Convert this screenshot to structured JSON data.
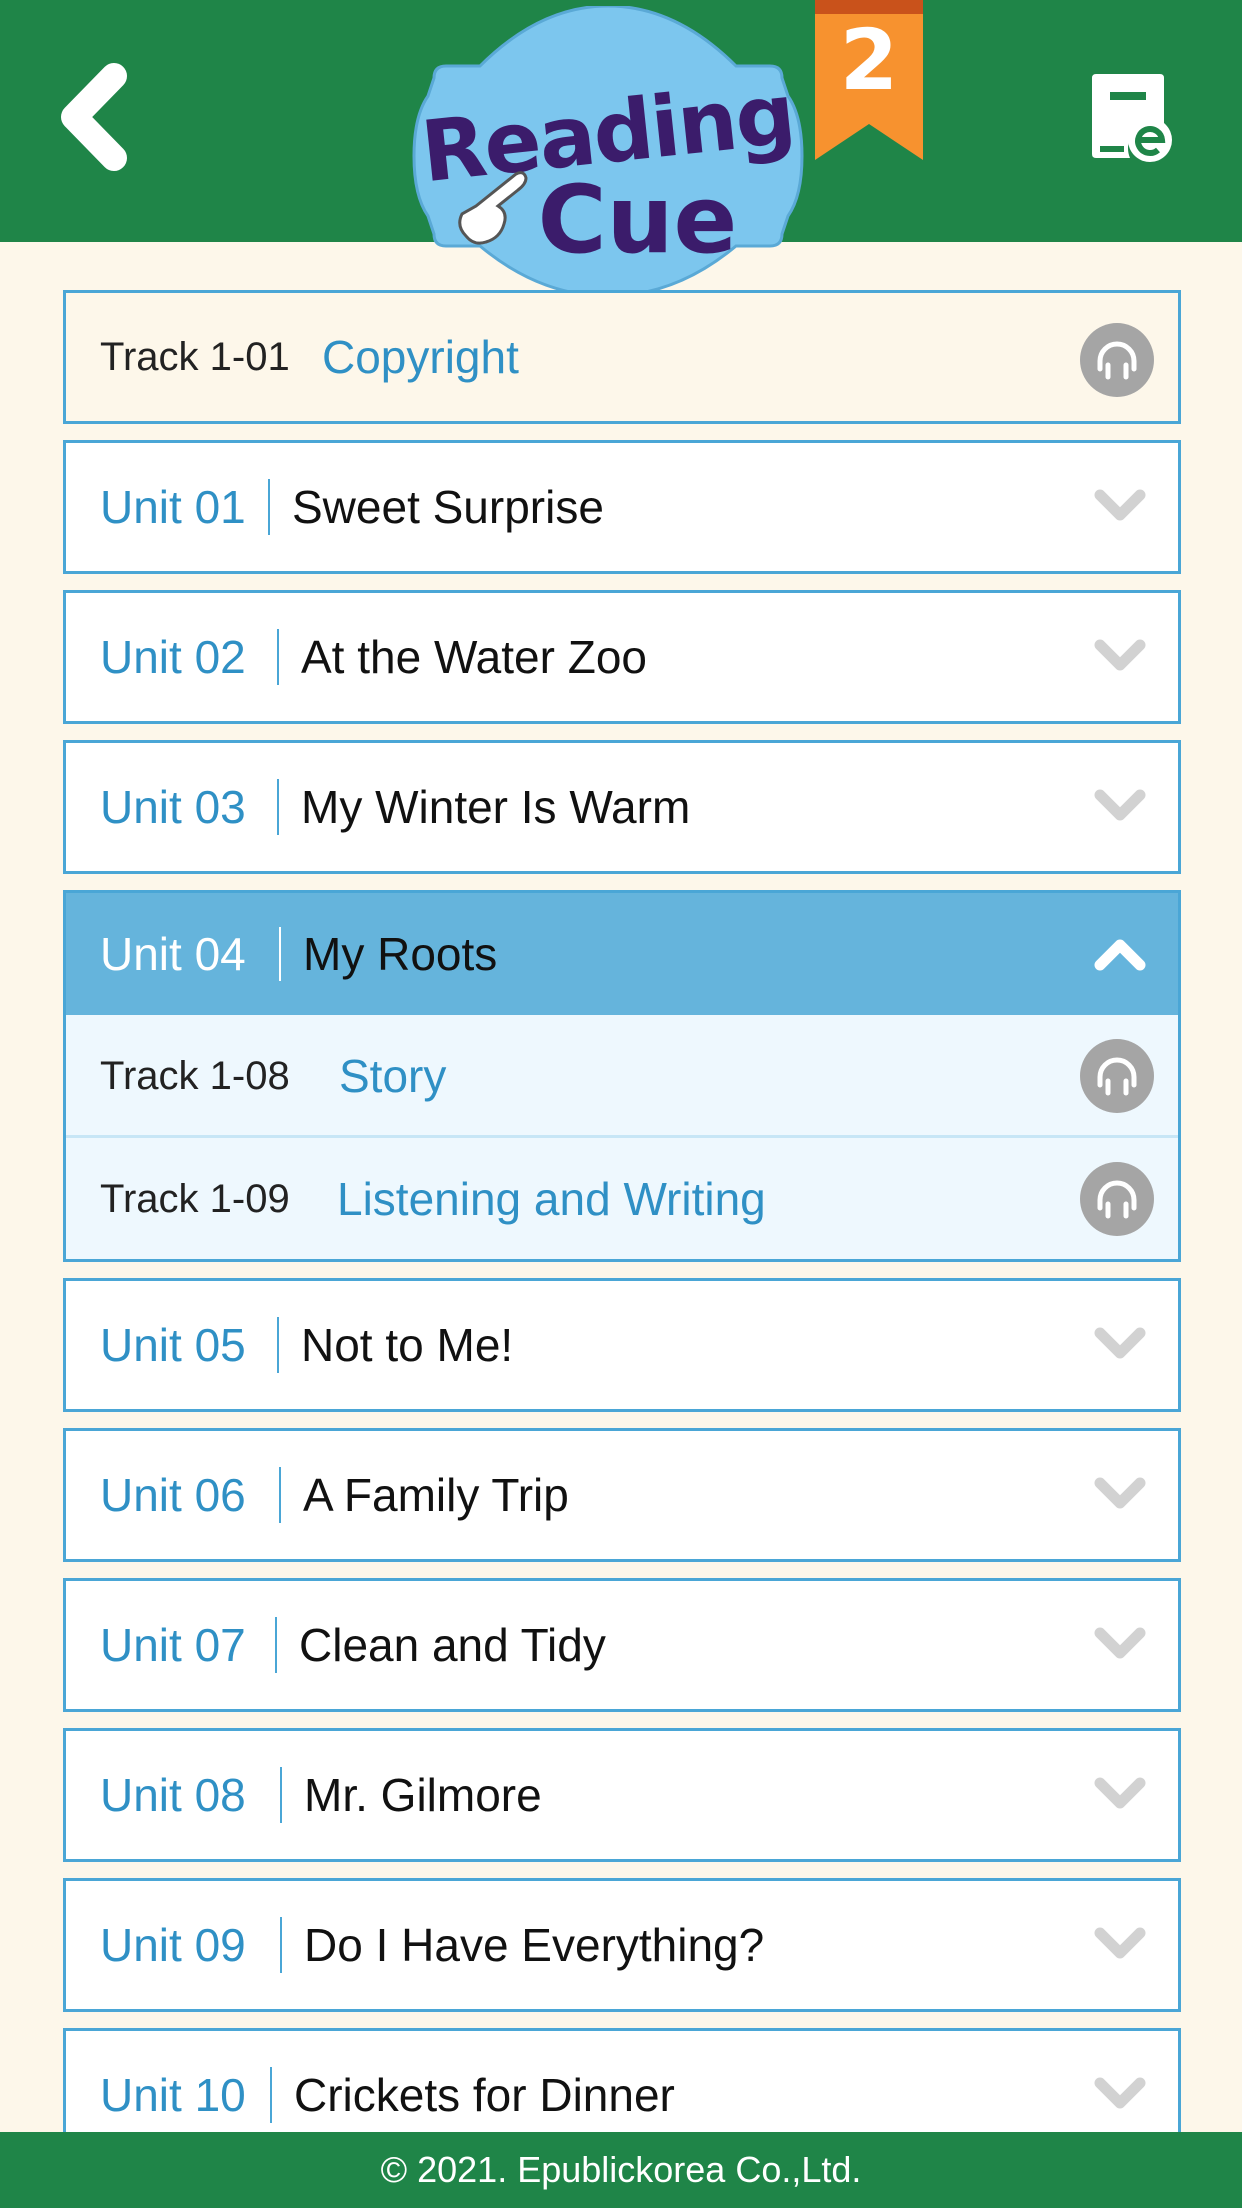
{
  "header": {
    "back_icon": "chevron-left-icon",
    "logo": {
      "line1": "Reading",
      "line2": "Cue"
    },
    "level_badge": "2",
    "ebook_icon": "ebook-icon"
  },
  "colors": {
    "header_green": "#1f8548",
    "page_bg": "#fdf7ea",
    "accent_blue": "#2f90c5",
    "border_blue": "#4aa6d6",
    "expanded_header_blue": "#65b4dc",
    "expanded_bg": "#eef8fe",
    "logo_blue": "#7cc6ee",
    "logo_purple": "#3b1c6b",
    "ribbon_orange": "#f7922f",
    "ribbon_top": "#c9521b",
    "listen_icon_gray": "#a5a5a5",
    "chevron_gray": "#d2d2d2"
  },
  "copyright_track": {
    "track": "Track 1-01",
    "title": "Copyright",
    "icon": "headphones-icon"
  },
  "units": [
    {
      "num": "Unit 01",
      "title": "Sweet Surprise",
      "expanded": false
    },
    {
      "num": "Unit 02",
      "title": "At the Water Zoo",
      "expanded": false
    },
    {
      "num": "Unit 03",
      "title": "My Winter Is Warm",
      "expanded": false
    },
    {
      "num": "Unit 04",
      "title": "My Roots",
      "expanded": true,
      "tracks": [
        {
          "track": "Track 1-08",
          "title": "Story",
          "icon": "headphones-icon"
        },
        {
          "track": "Track 1-09",
          "title": "Listening and Writing",
          "icon": "headphones-icon"
        }
      ]
    },
    {
      "num": "Unit 05",
      "title": "Not to Me!",
      "expanded": false
    },
    {
      "num": "Unit 06",
      "title": "A Family Trip",
      "expanded": false
    },
    {
      "num": "Unit 07",
      "title": "Clean and Tidy",
      "expanded": false
    },
    {
      "num": "Unit 08",
      "title": "Mr. Gilmore",
      "expanded": false
    },
    {
      "num": "Unit 09",
      "title": "Do I Have Everything?",
      "expanded": false
    },
    {
      "num": "Unit 10",
      "title": "Crickets for Dinner",
      "expanded": false
    }
  ],
  "footer": {
    "copyright": "© 2021. Epublickorea Co.,Ltd."
  }
}
